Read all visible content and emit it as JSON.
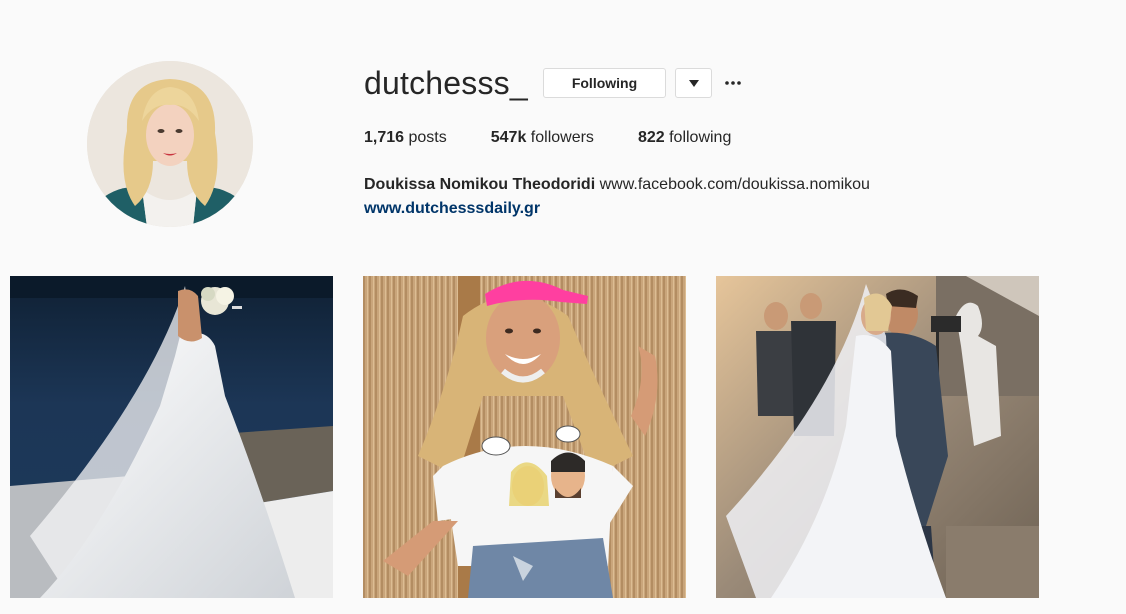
{
  "profile": {
    "username": "dutchesss_",
    "follow_label": "Following",
    "stats": [
      {
        "value": "1,716",
        "label": "posts"
      },
      {
        "value": "547k",
        "label": "followers"
      },
      {
        "value": "822",
        "label": "following"
      }
    ],
    "full_name": "Doukissa Nomikou Theodoridi",
    "bio_link": "www.facebook.com/doukissa.nomikou",
    "website": "www.dutchesssdaily.gr"
  },
  "icons": {
    "dropdown": "caret-down-icon",
    "more": "ellipsis-icon"
  },
  "posts": [
    {
      "name": "wedding-dress-photo"
    },
    {
      "name": "pink-cap-tshirt-photo"
    },
    {
      "name": "wedding-kiss-photo"
    }
  ],
  "colors": {
    "background": "#fafafa",
    "text": "#262626",
    "website_link": "#003569",
    "button_border": "#dbdbdb"
  }
}
